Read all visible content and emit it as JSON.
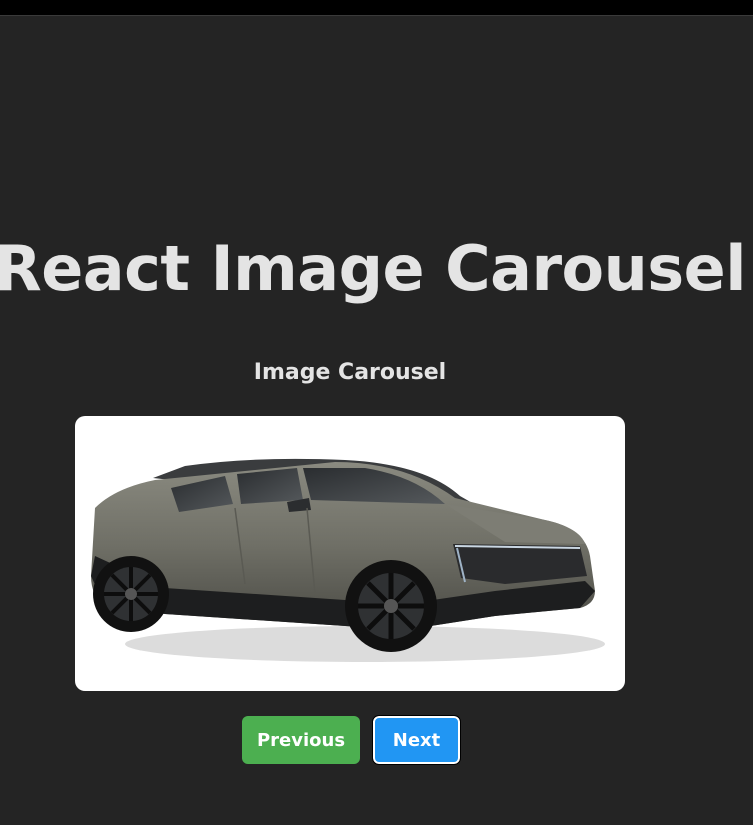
{
  "page": {
    "title": "React Image Carousel"
  },
  "carousel": {
    "heading": "Image Carousel",
    "image_subject": "car-suv",
    "buttons": {
      "previous_label": "Previous",
      "next_label": "Next"
    },
    "colors": {
      "background": "#242424",
      "previous_button": "#4caf50",
      "next_button": "#2196f3",
      "heading_text": "#e4e4e4"
    }
  }
}
